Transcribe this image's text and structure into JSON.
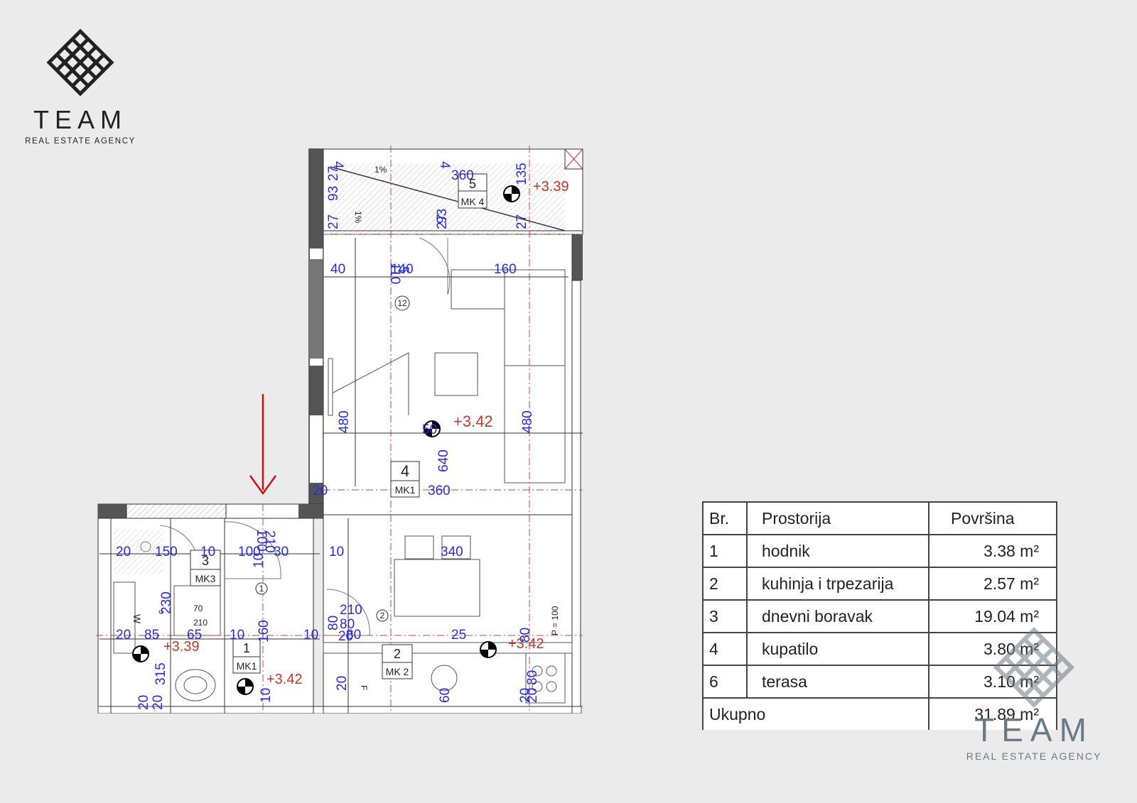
{
  "brand": {
    "name": "TEAM",
    "tagline": "REAL ESTATE AGENCY",
    "colors": {
      "dark": "#222222",
      "watermark": "#6b7a84"
    }
  },
  "plan": {
    "colors": {
      "dimension": "#2b2bd6",
      "level": "#c0392b",
      "wall": "#555555",
      "axis": "#d04040",
      "arrow": "#d01010"
    },
    "room_tags": [
      {
        "number": "5",
        "code": "MK 4"
      },
      {
        "number": "4",
        "code": "MK1"
      },
      {
        "number": "3",
        "code": "MK3"
      },
      {
        "number": "1",
        "code": "MK1"
      },
      {
        "number": "2",
        "code": "MK 2"
      }
    ],
    "levels": [
      "+3.39",
      "+3.42",
      "+3.42",
      "+3.39",
      "+3.42"
    ],
    "door_markers": [
      "12",
      "1",
      "2"
    ],
    "slopes": [
      "1%",
      "1%"
    ],
    "fixture_labels": [
      "W",
      "c",
      "70",
      "210",
      "F",
      "P = 100"
    ],
    "dimensions": [
      "4",
      "4",
      "27",
      "93",
      "360",
      "93",
      "135",
      "27",
      "27",
      "27",
      "40",
      "140",
      "160",
      "110",
      "5",
      "480",
      "480",
      "50",
      "640",
      "20",
      "360",
      "100",
      "210",
      "20",
      "150",
      "10",
      "100",
      "10",
      "30",
      "10",
      "340",
      "230",
      "80",
      "210",
      "80",
      "20",
      "85",
      "65",
      "10",
      "160",
      "10",
      "20",
      "80",
      "25",
      "315",
      "10",
      "20",
      "60",
      "20",
      "20",
      "80",
      "20",
      "80",
      "20"
    ]
  },
  "room_table": {
    "headers": {
      "no": "Br.",
      "room": "Prostorija",
      "area": "Površina"
    },
    "rows": [
      {
        "no": "1",
        "room": "hodnik",
        "area": "3.38 m²"
      },
      {
        "no": "2",
        "room": "kuhinja i trpezarija",
        "area": "2.57 m²"
      },
      {
        "no": "3",
        "room": "dnevni boravak",
        "area": "19.04 m²"
      },
      {
        "no": "4",
        "room": "kupatilo",
        "area": "3.80 m²"
      },
      {
        "no": "6",
        "room": "terasa",
        "area": "3.10 m²"
      }
    ],
    "total": {
      "label": "Ukupno",
      "area": "31.89 m²"
    }
  }
}
